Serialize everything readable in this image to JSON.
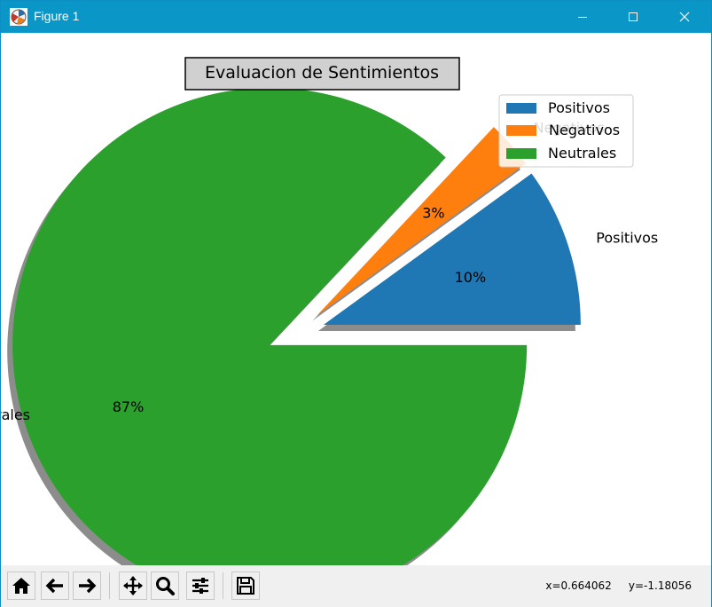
{
  "window": {
    "title": "Figure 1"
  },
  "toolbar": {
    "buttons": [
      "home-icon",
      "back-arrow-icon",
      "forward-arrow-icon",
      "pan-icon",
      "zoom-icon",
      "configure-subplots-icon",
      "save-icon"
    ],
    "coords_x": "x=0.664062",
    "coords_y": "y=-1.18056"
  },
  "colors": {
    "positivos": "#1f77b4",
    "negativos": "#ff7f0e",
    "neutrales": "#2ca02c",
    "titlebar": "#0b96c8"
  },
  "chart_data": {
    "type": "pie",
    "title": "Evaluacion de Sentimientos",
    "labels": [
      "Positivos",
      "Negativos",
      "Neutrales"
    ],
    "values": [
      10,
      3,
      87
    ],
    "pct_labels": [
      "10%",
      "3%",
      "87%"
    ],
    "explode": [
      0.1,
      0.1,
      0.1
    ],
    "shadow": true,
    "start_angle": 0,
    "legend": {
      "placement": "upper-right",
      "entries": [
        "Positivos",
        "Negativos",
        "Neutrales"
      ]
    },
    "clipped_label": "rales"
  }
}
